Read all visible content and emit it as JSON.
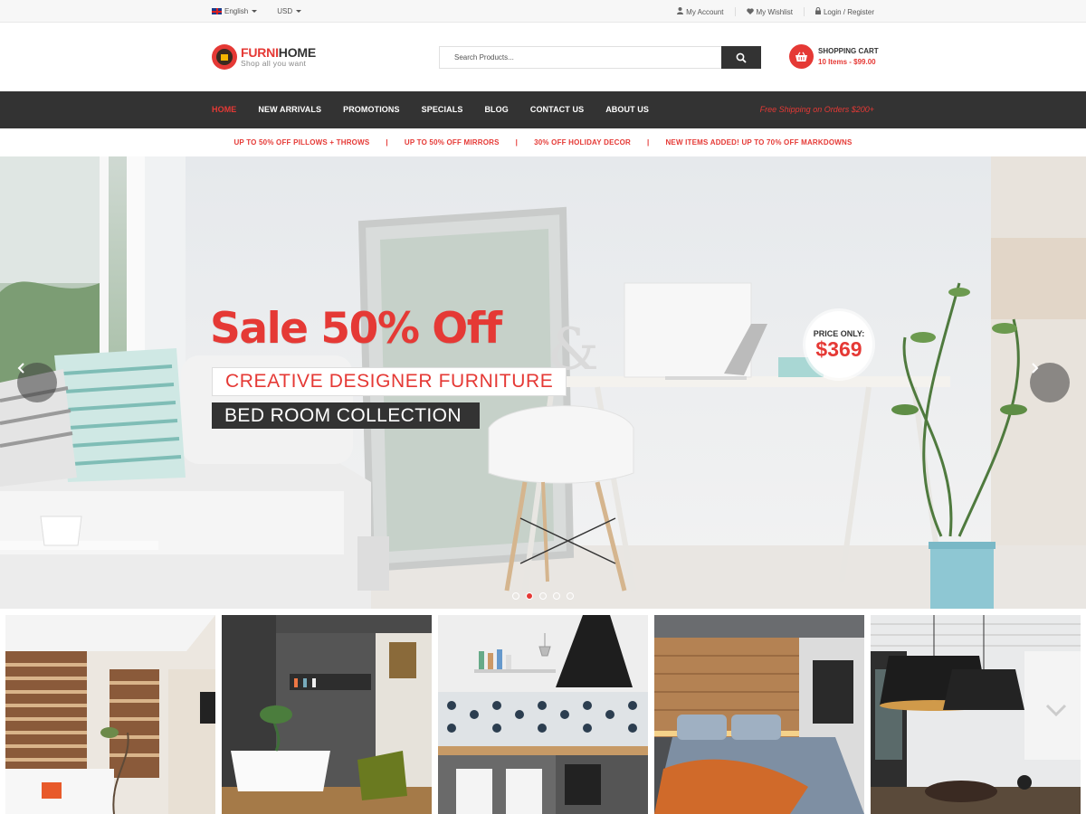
{
  "topbar": {
    "language": "English",
    "currency": "USD",
    "account": "My Account",
    "wishlist": "My Wishlist",
    "login": "Login / Register"
  },
  "brand": {
    "name_part1": "FURNI",
    "name_part2": "HOME",
    "tagline": "Shop all you want",
    "accent_color": "#e53935",
    "dark_color": "#333333"
  },
  "search": {
    "placeholder": "Search Products...",
    "icon": "search-icon"
  },
  "cart": {
    "title": "SHOPPING CART",
    "summary": "10 Items - $99.00",
    "icon": "basket-icon"
  },
  "nav": {
    "items": [
      {
        "label": "HOME",
        "active": true
      },
      {
        "label": "NEW ARRIVALS"
      },
      {
        "label": "PROMOTIONS"
      },
      {
        "label": "SPECIALS"
      },
      {
        "label": "BLOG"
      },
      {
        "label": "CONTACT US"
      },
      {
        "label": "ABOUT US"
      }
    ],
    "shipping_note": "Free Shipping on Orders $200+"
  },
  "promos": [
    "UP TO 50% OFF PILLOWS + THROWS",
    "UP TO 50% OFF MIRRORS",
    "30% OFF HOLIDAY DECOR",
    "NEW ITEMS ADDED! UP TO 70% OFF MARKDOWNS"
  ],
  "promo_separator": "|",
  "hero": {
    "headline": "Sale 50% Off",
    "subtitle1": "CREATIVE DESIGNER FURNITURE",
    "subtitle2": "BED ROOM COLLECTION",
    "price_label": "PRICE ONLY:",
    "price_value": "$369",
    "slide_count": 5,
    "active_slide": 2
  },
  "thumbnails": [
    {
      "scene": "living-room"
    },
    {
      "scene": "bathroom"
    },
    {
      "scene": "kitchen"
    },
    {
      "scene": "bedroom"
    },
    {
      "scene": "dining-room"
    }
  ]
}
